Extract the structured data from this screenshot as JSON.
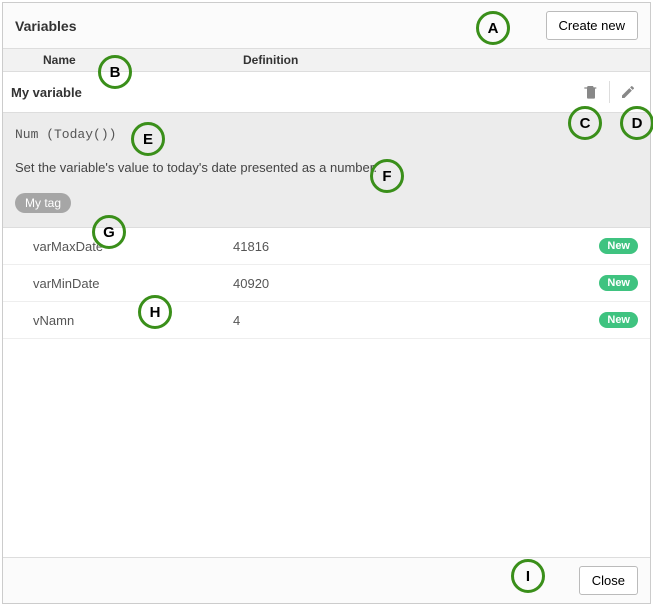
{
  "header": {
    "title": "Variables",
    "create_btn": "Create new"
  },
  "columns": {
    "name": "Name",
    "definition": "Definition"
  },
  "selected": {
    "name": "My variable",
    "formula": "Num (Today())",
    "description": "Set the variable's value to today's date presented as a number.",
    "tag": "My tag"
  },
  "variables": [
    {
      "name": "varMaxDate",
      "definition": "41816",
      "badge": "New"
    },
    {
      "name": "varMinDate",
      "definition": "40920",
      "badge": "New"
    },
    {
      "name": "vNamn",
      "definition": "4",
      "badge": "New"
    }
  ],
  "footer": {
    "close_btn": "Close"
  },
  "annotations": {
    "A": "A",
    "B": "B",
    "C": "C",
    "D": "D",
    "E": "E",
    "F": "F",
    "G": "G",
    "H": "H",
    "I": "I"
  }
}
